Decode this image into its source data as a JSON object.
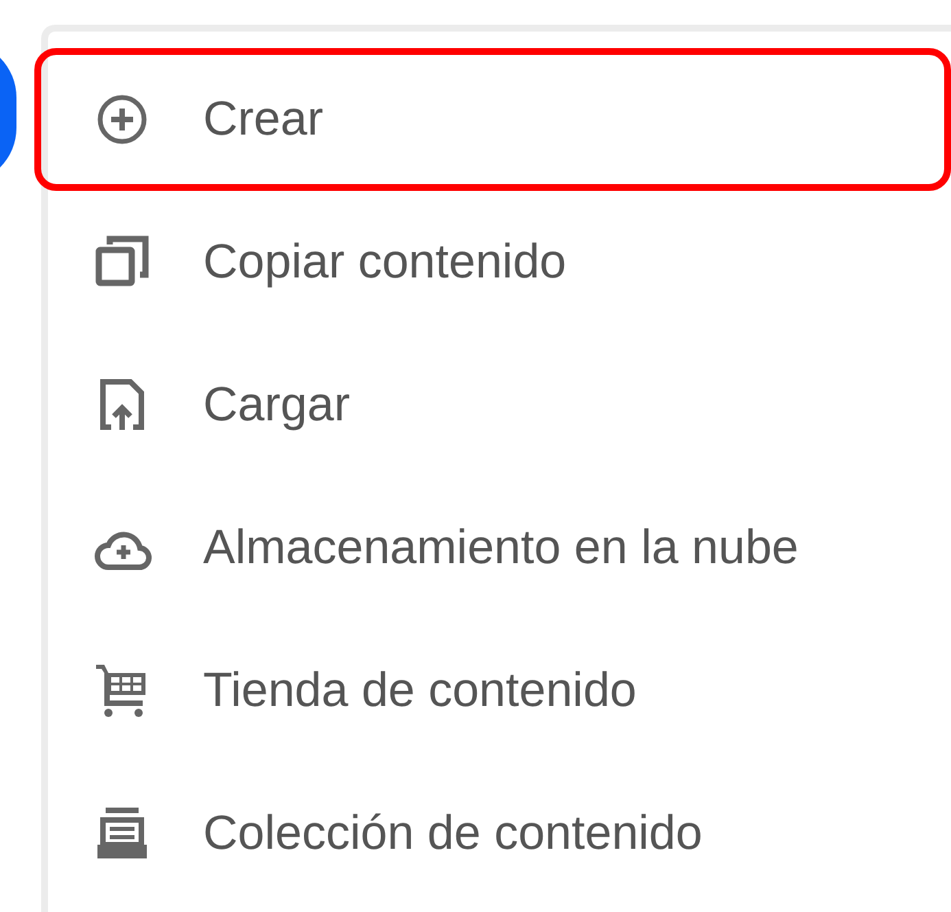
{
  "menu": {
    "items": [
      {
        "label": "Crear",
        "selected": true
      },
      {
        "label": "Copiar contenido",
        "selected": false
      },
      {
        "label": "Cargar",
        "selected": false
      },
      {
        "label": "Almacenamiento en la nube",
        "selected": false
      },
      {
        "label": "Tienda de contenido",
        "selected": false
      },
      {
        "label": "Colección de contenido",
        "selected": false
      }
    ]
  }
}
